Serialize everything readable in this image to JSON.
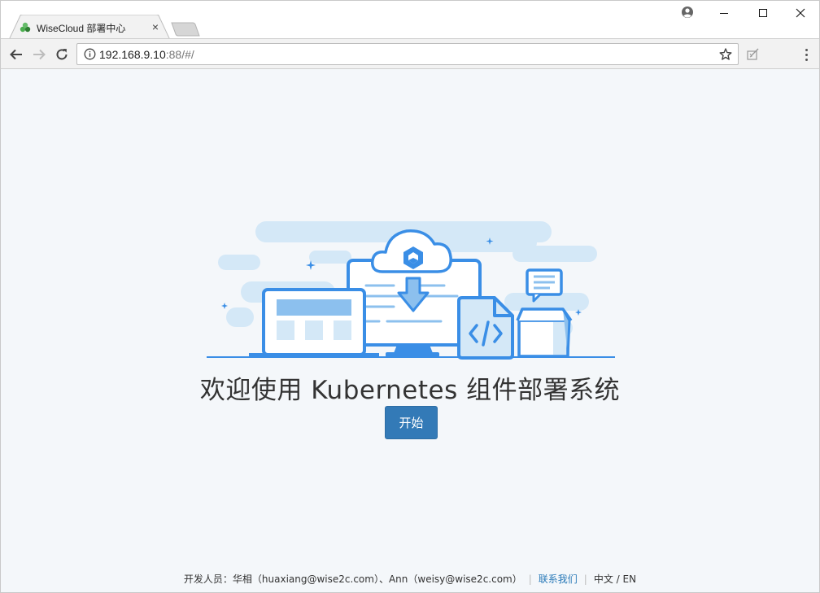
{
  "browser": {
    "tab_title": "WiseCloud 部署中心",
    "address": {
      "host": "192.168.9.10",
      "rest": ":88/#/"
    },
    "icons": {
      "favicon": "wisecloud-logo-icon",
      "back": "arrow-left-icon",
      "forward": "arrow-right-icon",
      "reload": "reload-icon",
      "info": "info-icon",
      "bookmark": "star-icon",
      "extension": "extension-icon",
      "menu": "kebab-menu-icon",
      "profile": "profile-icon",
      "minimize": "minimize-icon",
      "maximize": "maximize-icon",
      "close": "close-icon"
    }
  },
  "main": {
    "welcome_text": "欢迎使用 Kubernetes 组件部署系统",
    "start_button": "开始"
  },
  "footer": {
    "developers_label": "开发人员：",
    "dev1": "华相（huaxiang@wise2c.com）",
    "separator": "、",
    "dev2": "Ann（weisy@wise2c.com）",
    "contact_link": "联系我们",
    "lang_zh": "中文",
    "lang_slash": " / ",
    "lang_en": "EN"
  },
  "colors": {
    "accent": "#337ab7",
    "illustration_blue": "#3a8ee6",
    "illustration_light": "#d4e8f7",
    "page_bg": "#f4f7fa",
    "link": "#2a7ab8"
  }
}
